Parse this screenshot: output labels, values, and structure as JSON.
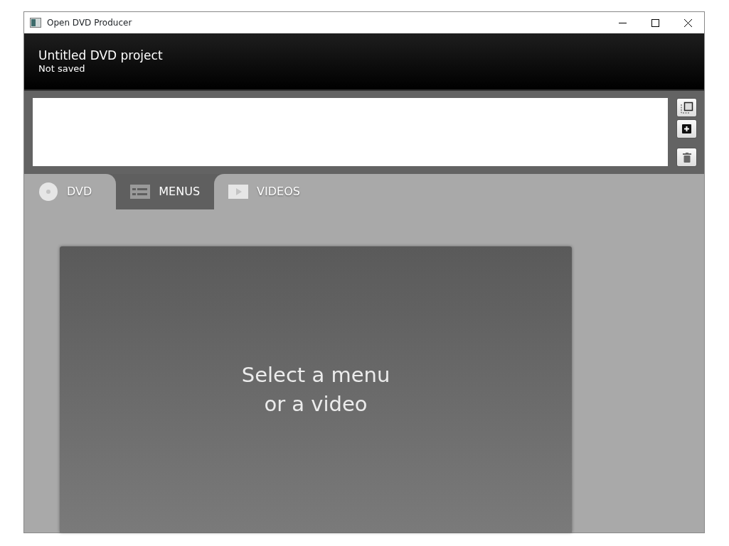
{
  "window": {
    "title": "Open DVD Producer"
  },
  "project": {
    "title": "Untitled DVD project",
    "status": "Not saved"
  },
  "side_buttons": [
    {
      "kind": "select"
    },
    {
      "kind": "add"
    },
    {
      "kind": "delete"
    }
  ],
  "tabs": [
    {
      "label": "DVD",
      "kind": "disc",
      "selected": false
    },
    {
      "label": "MENUS",
      "kind": "menu",
      "selected": true
    },
    {
      "label": "VIDEOS",
      "kind": "video",
      "selected": false
    }
  ],
  "preview": {
    "message_lines": [
      "Select a menu",
      "or a video"
    ]
  }
}
